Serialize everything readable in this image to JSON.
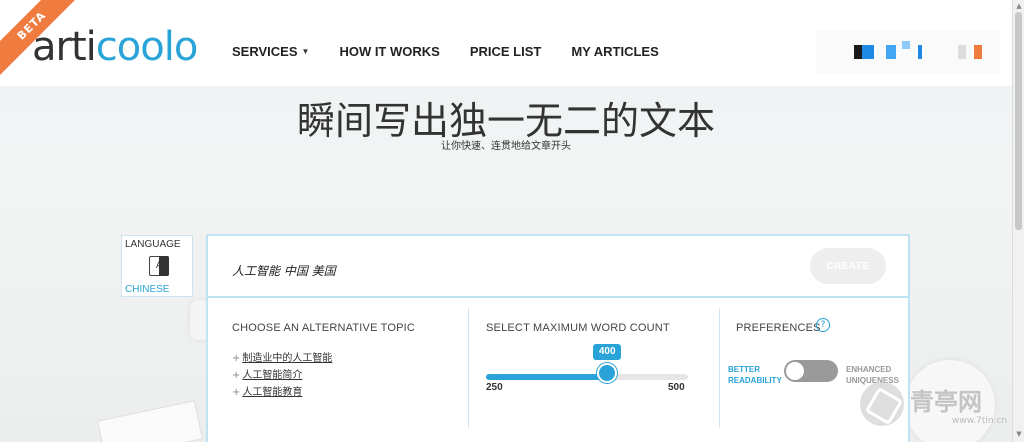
{
  "header": {
    "beta_label": "BETA",
    "logo_left": "arti",
    "logo_mid": "coo",
    "logo_right": "lo",
    "nav": [
      {
        "label": "SERVICES",
        "dropdown": true
      },
      {
        "label": "HOW IT WORKS"
      },
      {
        "label": "PRICE LIST"
      },
      {
        "label": "MY ARTICLES"
      }
    ]
  },
  "hero": {
    "title": "瞬间写出独一无二的文本",
    "subtitle": "让你快速、连贯地给文章开头"
  },
  "language": {
    "label": "LANGUAGE",
    "value": "CHINESE",
    "icon": "translate-icon"
  },
  "topic": {
    "value": "人工智能 中国 美国",
    "create_label": "CREATE"
  },
  "alternatives": {
    "heading": "CHOOSE AN ALTERNATIVE TOPIC",
    "items": [
      "制造业中的人工智能",
      "人工智能简介",
      "人工智能教育"
    ]
  },
  "word_count": {
    "heading": "SELECT MAXIMUM WORD COUNT",
    "min": 250,
    "max": 500,
    "value": 400,
    "min_label": "250",
    "max_label": "500",
    "value_label": "400"
  },
  "preferences": {
    "heading": "PREFERENCES",
    "left_line1": "BETTER",
    "left_line2": "READABILITY",
    "right_line1": "ENHANCED",
    "right_line2": "UNIQUENESS",
    "toggle_on": false
  },
  "watermark": {
    "text": "青亭网",
    "url": "www.7tin.cn"
  },
  "colors": {
    "accent": "#2aa3d8",
    "beta": "#f07b3f"
  }
}
